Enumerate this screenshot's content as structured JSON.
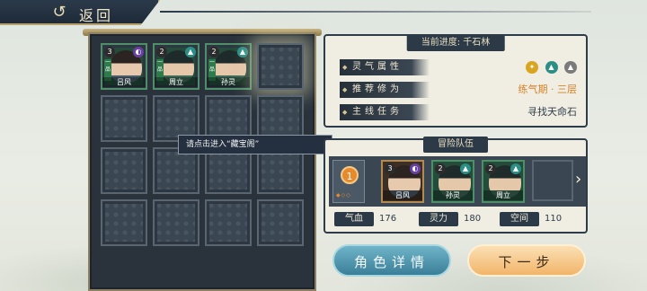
{
  "nav": {
    "back_label": "返回"
  },
  "grid": {
    "characters": [
      {
        "name": "吕风",
        "level": "3",
        "rank": "一品",
        "element": "purple"
      },
      {
        "name": "周立",
        "level": "2",
        "rank": "一品",
        "element": "teal"
      },
      {
        "name": "孙灵",
        "level": "2",
        "rank": "一品",
        "element": "teal"
      }
    ],
    "tooltip": "请点击进入“藏宝阁”"
  },
  "info": {
    "title": "当前进度: 千石林",
    "rows": [
      {
        "label": "灵气属性",
        "value": ""
      },
      {
        "label": "推荐修为",
        "value": "练气期 · 三层"
      },
      {
        "label": "主线任务",
        "value": "寻找天命石"
      }
    ]
  },
  "team": {
    "title": "冒险队伍",
    "leader_number": "1",
    "members": [
      {
        "name": "吕风",
        "level": "3"
      },
      {
        "name": "孙灵",
        "level": "2"
      },
      {
        "name": "周立",
        "level": "2"
      }
    ],
    "stats": [
      {
        "label": "气血",
        "value": "176"
      },
      {
        "label": "灵力",
        "value": "180"
      },
      {
        "label": "空间",
        "value": "110"
      }
    ]
  },
  "buttons": {
    "detail": "角色详情",
    "next": "下一步"
  },
  "colors": {
    "accent_orange": "#d9822b",
    "panel_dark": "#2e3b48",
    "teal_button": "#3a7f98",
    "orange_button": "#f2b56a"
  }
}
